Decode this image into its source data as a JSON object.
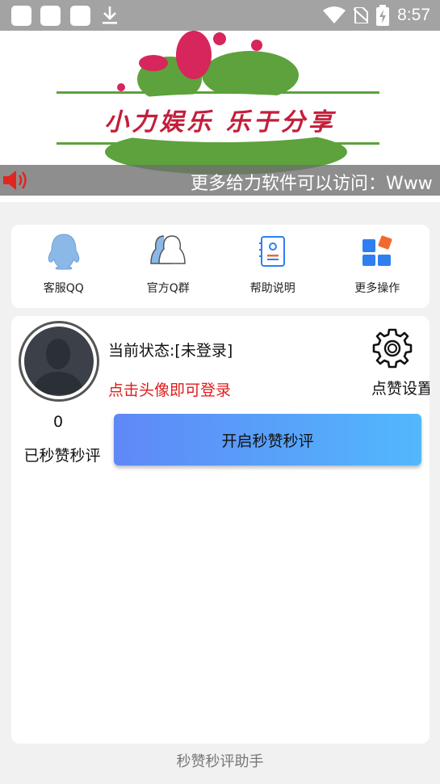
{
  "status_bar": {
    "time": "8:57"
  },
  "banner": {
    "logo_text": "小力娱乐 乐于分享",
    "marquee_text": "更多给力软件可以访问：Www"
  },
  "grid": {
    "items": [
      {
        "label": "客服QQ",
        "icon": "qq-penguin-icon"
      },
      {
        "label": "官方Q群",
        "icon": "group-users-icon"
      },
      {
        "label": "帮助说明",
        "icon": "document-icon"
      },
      {
        "label": "更多操作",
        "icon": "blocks-icon"
      }
    ]
  },
  "main": {
    "status": "当前状态:[未登录]",
    "login_hint": "点击头像即可登录",
    "like_settings_label": "点赞设置",
    "count": "0",
    "count_label": "已秒赞秒评",
    "start_button_label": "开启秒赞秒评"
  },
  "footer": {
    "title": "秒赞秒评助手"
  },
  "colors": {
    "status_bar": "#a3a3a3",
    "login_hint": "#e01b1b",
    "button_gradient_start": "#5f88f7",
    "button_gradient_end": "#52b8fc",
    "icon_blue": "#2f7ff0",
    "icon_orange": "#f06a2f"
  }
}
